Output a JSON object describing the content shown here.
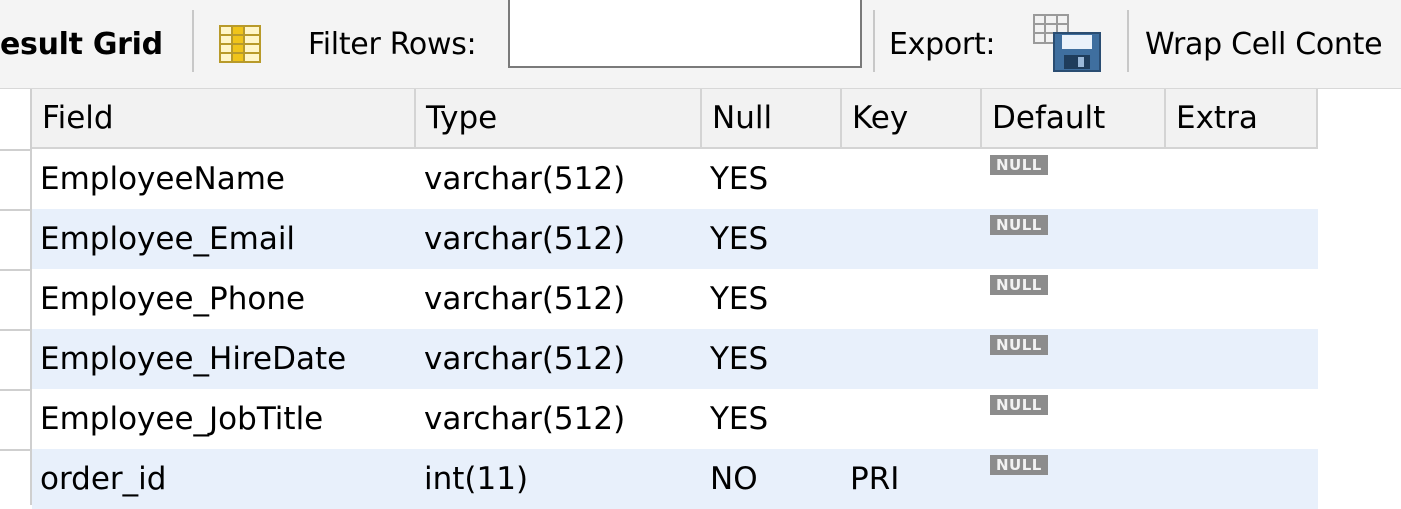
{
  "toolbar": {
    "result_grid_label": "esult Grid",
    "filter_rows_label": "Filter Rows:",
    "filter_value": "",
    "export_label": "Export:",
    "wrap_label": "Wrap Cell Conte"
  },
  "grid": {
    "columns": [
      "Field",
      "Type",
      "Null",
      "Key",
      "Default",
      "Extra"
    ],
    "rows": [
      {
        "field": "EmployeeName",
        "type": "varchar(512)",
        "null": "YES",
        "key": "",
        "default": "NULL",
        "extra": ""
      },
      {
        "field": "Employee_Email",
        "type": "varchar(512)",
        "null": "YES",
        "key": "",
        "default": "NULL",
        "extra": ""
      },
      {
        "field": "Employee_Phone",
        "type": "varchar(512)",
        "null": "YES",
        "key": "",
        "default": "NULL",
        "extra": ""
      },
      {
        "field": "Employee_HireDate",
        "type": "varchar(512)",
        "null": "YES",
        "key": "",
        "default": "NULL",
        "extra": ""
      },
      {
        "field": "Employee_JobTitle",
        "type": "varchar(512)",
        "null": "YES",
        "key": "",
        "default": "NULL",
        "extra": ""
      },
      {
        "field": "order_id",
        "type": "int(11)",
        "null": "NO",
        "key": "PRI",
        "default": "NULL",
        "extra": ""
      }
    ]
  },
  "icons": {
    "grid_toggle": "column-grid-icon",
    "export": "export-save-icon"
  },
  "colors": {
    "toolbar_bg": "#f4f4f4",
    "header_bg": "#f2f2f2",
    "alt_row_bg": "#e8f0fb",
    "null_badge_bg": "#8c8c8c"
  }
}
